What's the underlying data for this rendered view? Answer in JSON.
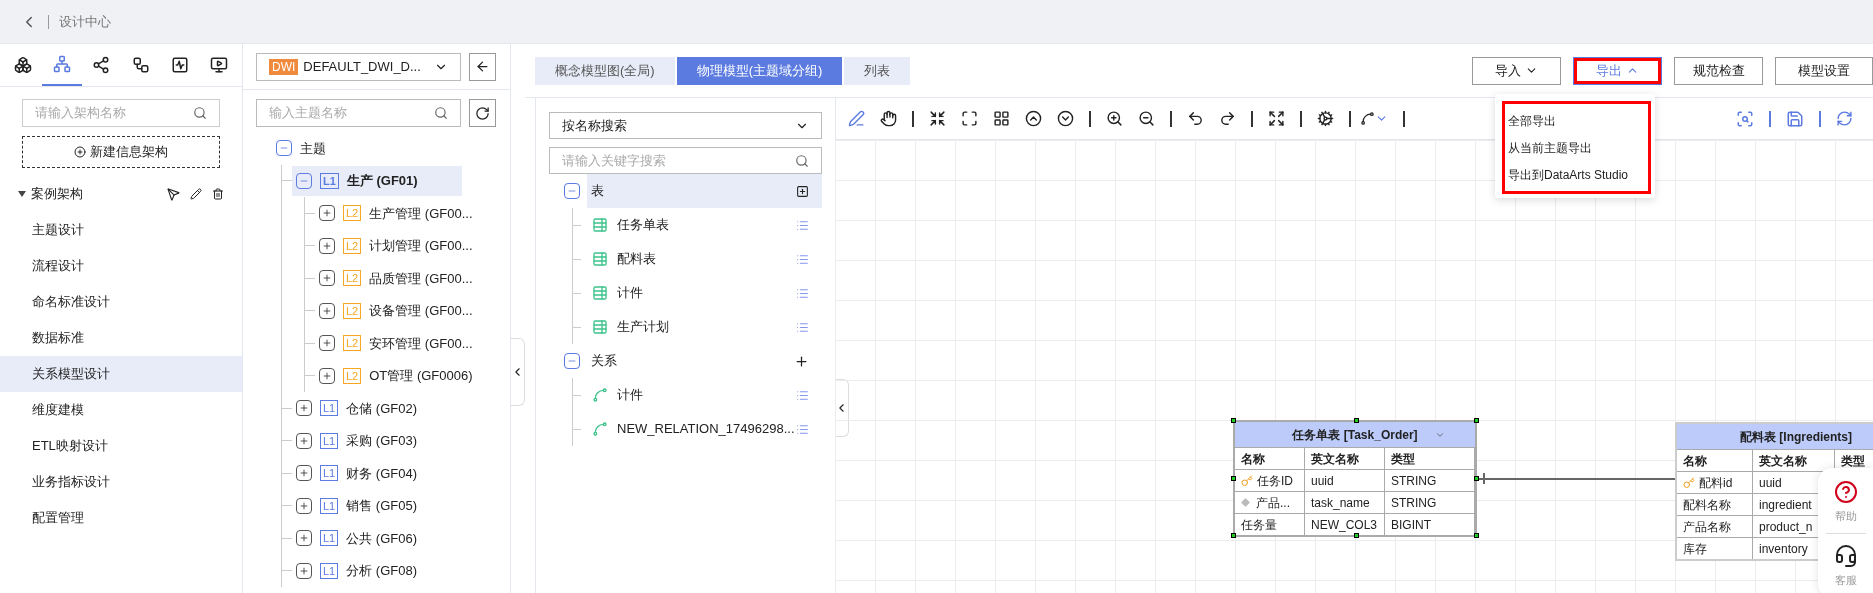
{
  "header": {
    "title": "设计中心"
  },
  "sidebar": {
    "tool_tabs": [
      {
        "selected": false
      },
      {
        "selected": true
      },
      {
        "selected": false
      },
      {
        "selected": false
      },
      {
        "selected": false
      },
      {
        "selected": false
      }
    ],
    "search": {
      "placeholder": "请输入架构名称"
    },
    "new_button": "新建信息架构",
    "tree": {
      "label": "案例架构",
      "expanded": true,
      "items": [
        {
          "label": "主题设计",
          "selected": false
        },
        {
          "label": "流程设计",
          "selected": false
        },
        {
          "label": "命名标准设计",
          "selected": false
        },
        {
          "label": "数据标准",
          "selected": false
        },
        {
          "label": "关系模型设计",
          "selected": true
        },
        {
          "label": "维度建模",
          "selected": false
        },
        {
          "label": "ETL映射设计",
          "selected": false
        },
        {
          "label": "业务指标设计",
          "selected": false
        },
        {
          "label": "配置管理",
          "selected": false
        }
      ]
    }
  },
  "subject_panel": {
    "dropdown": {
      "badge": "DWI",
      "value": "DEFAULT_DWI_D..."
    },
    "search": {
      "placeholder": "输入主题名称"
    },
    "tree": [
      {
        "label": "主题",
        "expanded": true,
        "selected": false,
        "children": [
          {
            "tier": "L1",
            "label": "生产 (GF01)",
            "expanded": true,
            "selected": true,
            "children": [
              {
                "tier": "L2",
                "label": "生产管理 (GF00...",
                "expanded": false,
                "selected": false
              },
              {
                "tier": "L2",
                "label": "计划管理 (GF00...",
                "expanded": false,
                "selected": false
              },
              {
                "tier": "L2",
                "label": "品质管理 (GF00...",
                "expanded": false,
                "selected": false
              },
              {
                "tier": "L2",
                "label": "设备管理 (GF00...",
                "expanded": false,
                "selected": false
              },
              {
                "tier": "L2",
                "label": "安环管理 (GF00...",
                "expanded": false,
                "selected": false
              },
              {
                "tier": "L2",
                "label": "OT管理 (GF0006)",
                "expanded": false,
                "selected": false
              }
            ]
          },
          {
            "tier": "L1",
            "label": "仓储 (GF02)",
            "expanded": false,
            "selected": false
          },
          {
            "tier": "L1",
            "label": "采购 (GF03)",
            "expanded": false,
            "selected": false
          },
          {
            "tier": "L1",
            "label": "财务 (GF04)",
            "expanded": false,
            "selected": false
          },
          {
            "tier": "L1",
            "label": "销售 (GF05)",
            "expanded": false,
            "selected": false
          },
          {
            "tier": "L1",
            "label": "公共 (GF06)",
            "expanded": false,
            "selected": false
          },
          {
            "tier": "L1",
            "label": "分析 (GF08)",
            "expanded": false,
            "selected": false
          }
        ]
      }
    ]
  },
  "tabs": [
    {
      "label": "概念模型图(全局)",
      "selected": false
    },
    {
      "label": "物理模型(主题域分组)",
      "selected": true
    },
    {
      "label": "列表",
      "selected": false
    }
  ],
  "object_panel": {
    "search_mode": "按名称搜索",
    "search": {
      "placeholder": "请输入关键字搜索"
    },
    "groups": [
      {
        "kind": "table",
        "label": "表",
        "expanded": true,
        "selected": true,
        "items": [
          {
            "label": "任务单表"
          },
          {
            "label": "配料表"
          },
          {
            "label": "计件"
          },
          {
            "label": "生产计划"
          }
        ]
      },
      {
        "kind": "relation",
        "label": "关系",
        "expanded": true,
        "selected": false,
        "items": [
          {
            "label": "计件"
          },
          {
            "label": "NEW_RELATION_17496298..."
          }
        ]
      }
    ]
  },
  "actions": [
    {
      "label": "导入",
      "dropdown": true,
      "open": false,
      "highlighted": false
    },
    {
      "label": "导出",
      "dropdown": true,
      "open": true,
      "highlighted": true
    },
    {
      "label": "规范检查",
      "dropdown": false,
      "open": false,
      "highlighted": false
    },
    {
      "label": "模型设置",
      "dropdown": false,
      "open": false,
      "highlighted": false
    }
  ],
  "export_menu": {
    "highlighted": true,
    "items": [
      "全部导出",
      "从当前主题导出",
      "导出到DataArts Studio"
    ]
  },
  "toolbar": {
    "pen_active": true
  },
  "diagram": {
    "entities": [
      {
        "title": "任务单表 [Task_Order]",
        "selected": true,
        "collapsible": true,
        "columns": [
          "名称",
          "英文名称",
          "类型"
        ],
        "rows": [
          {
            "kind": "primary",
            "cells": [
              "任务ID",
              "uuid",
              "STRING"
            ]
          },
          {
            "kind": "index",
            "cells": [
              "产品...",
              "task_name",
              "STRING"
            ]
          },
          {
            "kind": "plain",
            "cells": [
              "任务量",
              "NEW_COL3",
              "BIGINT"
            ]
          }
        ]
      },
      {
        "title": "配料表 [Ingredients]",
        "selected": false,
        "columns": [
          "名称",
          "英文名称",
          "类型"
        ],
        "rows": [
          {
            "kind": "primary",
            "cells": [
              "配料id",
              "uuid"
            ]
          },
          {
            "kind": "plain",
            "cells": [
              "配料名称",
              "ingredient"
            ]
          },
          {
            "kind": "plain",
            "cells": [
              "产品名称",
              "product_n"
            ]
          },
          {
            "kind": "plain",
            "cells": [
              "库存",
              "inventory"
            ]
          }
        ]
      }
    ]
  },
  "help_widget": [
    {
      "kind": "help",
      "label": "帮助"
    },
    {
      "kind": "service",
      "label": "客服"
    }
  ]
}
